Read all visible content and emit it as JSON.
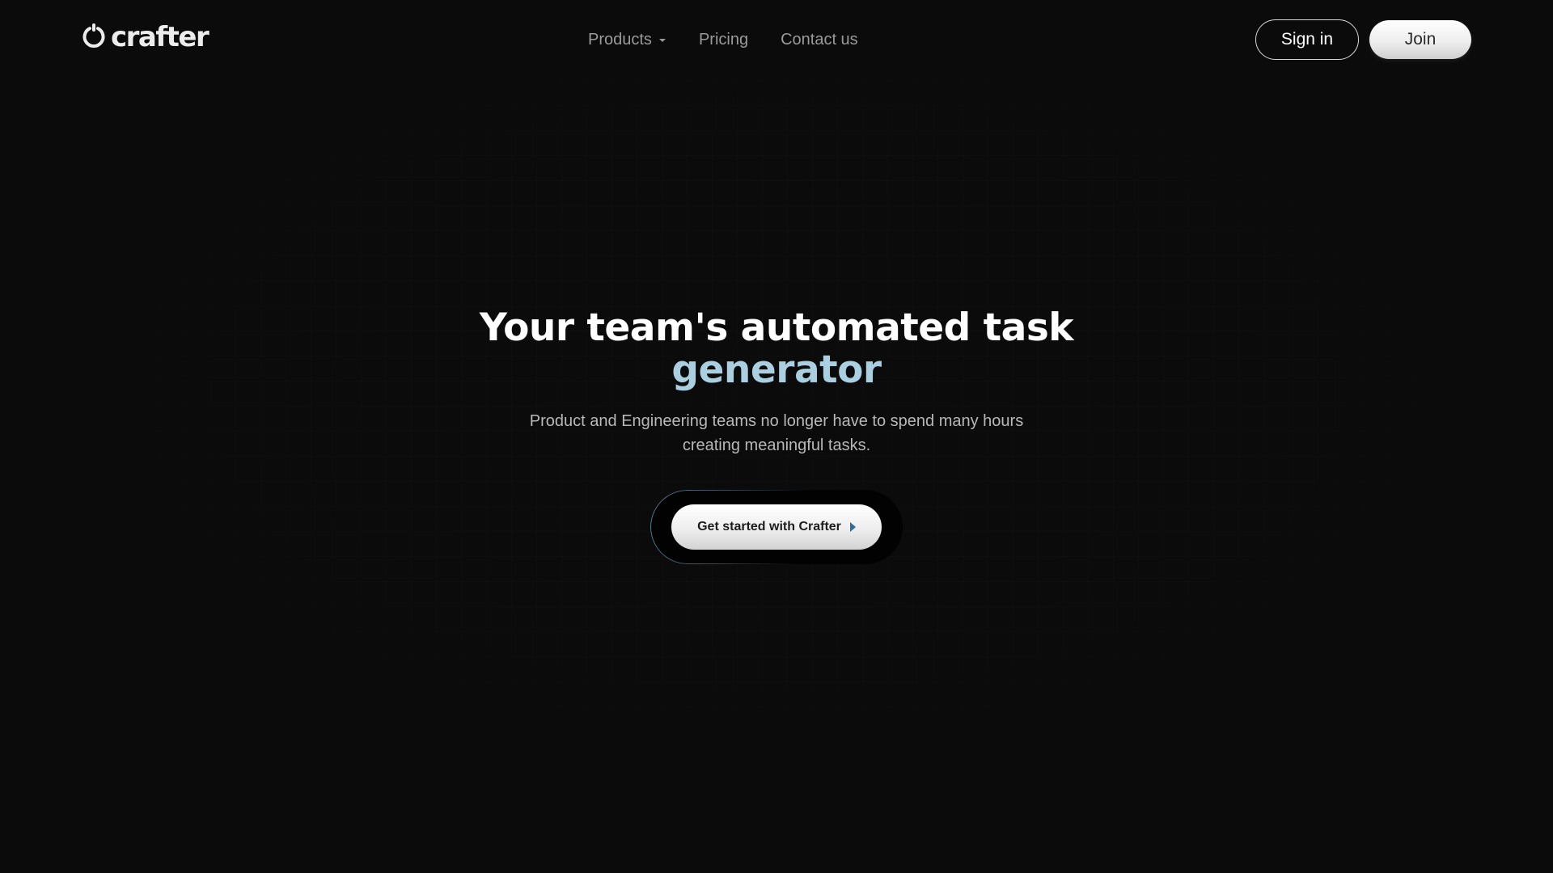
{
  "brand": {
    "name": "crafter",
    "logo_icon": "crafter-logo-icon"
  },
  "nav": {
    "items": [
      {
        "label": "Products",
        "has_dropdown": true,
        "icon": "caret-down-icon"
      },
      {
        "label": "Pricing"
      },
      {
        "label": "Contact us"
      }
    ]
  },
  "auth": {
    "sign_in_label": "Sign in",
    "join_label": "Join"
  },
  "hero": {
    "title_line1": "Your team's automated task",
    "title_line2": "generator",
    "subtitle_line1": "Product and Engineering teams no longer have to spend many hours",
    "subtitle_line2": "creating meaningful tasks.",
    "cta_label": "Get started with Crafter",
    "cta_icon": "play-arrow-icon"
  },
  "colors": {
    "background": "#0b0b0c",
    "accent": "#a9cfe0",
    "cta_icon": "#2a6f9a",
    "nav_text": "#9a9a9a"
  }
}
